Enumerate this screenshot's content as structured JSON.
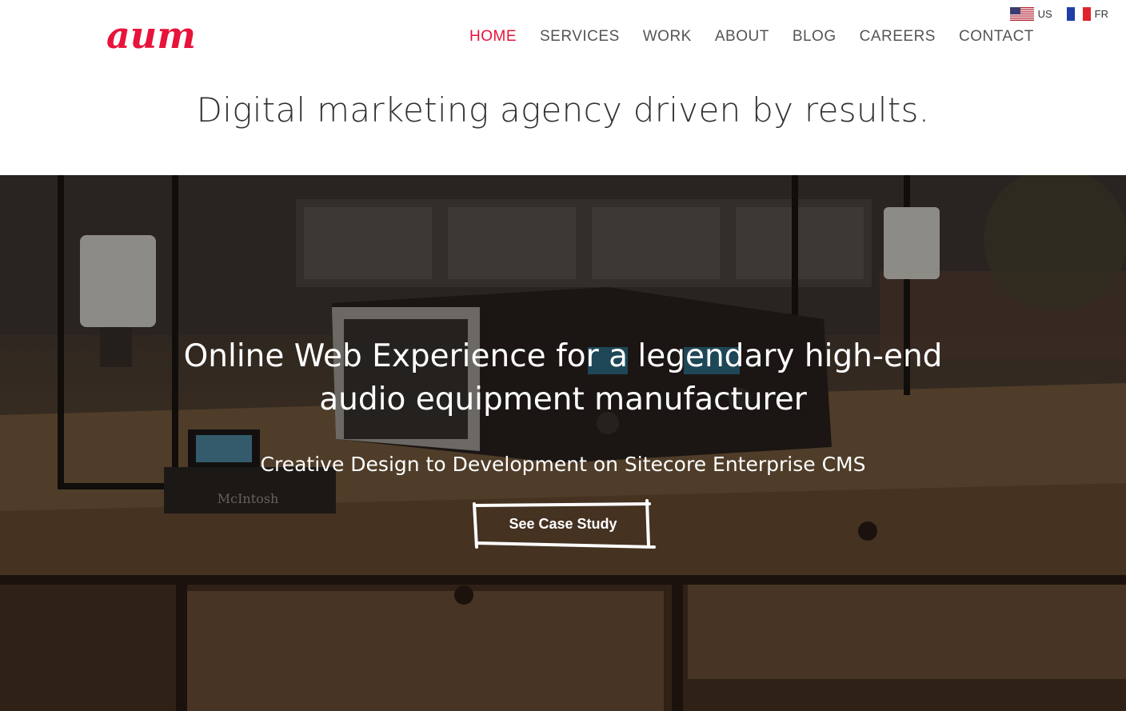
{
  "brand": {
    "logo_text": "aum",
    "accent_color": "#e8133a",
    "logo_icon": "aum-logo"
  },
  "nav": {
    "items": [
      {
        "label": "HOME",
        "active": true
      },
      {
        "label": "SERVICES",
        "active": false
      },
      {
        "label": "WORK",
        "active": false
      },
      {
        "label": "ABOUT",
        "active": false
      },
      {
        "label": "BLOG",
        "active": false
      },
      {
        "label": "CAREERS",
        "active": false
      },
      {
        "label": "CONTACT",
        "active": false
      }
    ]
  },
  "languages": [
    {
      "code": "US",
      "icon": "us-flag-icon"
    },
    {
      "code": "FR",
      "icon": "fr-flag-icon"
    }
  ],
  "tagline": "Digital marketing agency driven by results.",
  "hero": {
    "title_line1": "Online Web Experience for a legendary high-end",
    "title_line2": "audio equipment manufacturer",
    "subtitle": "Creative Design to Development on Sitecore Enterprise CMS",
    "cta_label": "See Case Study",
    "image_brand_text": "McIntosh"
  }
}
